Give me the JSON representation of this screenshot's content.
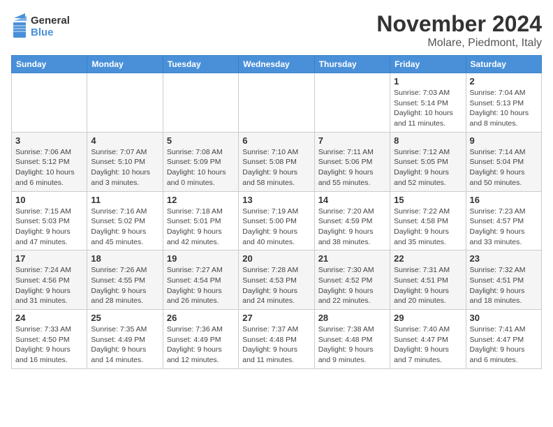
{
  "header": {
    "logo_general": "General",
    "logo_blue": "Blue",
    "month_title": "November 2024",
    "location": "Molare, Piedmont, Italy"
  },
  "days_of_week": [
    "Sunday",
    "Monday",
    "Tuesday",
    "Wednesday",
    "Thursday",
    "Friday",
    "Saturday"
  ],
  "weeks": [
    [
      {
        "day": "",
        "info": ""
      },
      {
        "day": "",
        "info": ""
      },
      {
        "day": "",
        "info": ""
      },
      {
        "day": "",
        "info": ""
      },
      {
        "day": "",
        "info": ""
      },
      {
        "day": "1",
        "info": "Sunrise: 7:03 AM\nSunset: 5:14 PM\nDaylight: 10 hours and 11 minutes."
      },
      {
        "day": "2",
        "info": "Sunrise: 7:04 AM\nSunset: 5:13 PM\nDaylight: 10 hours and 8 minutes."
      }
    ],
    [
      {
        "day": "3",
        "info": "Sunrise: 7:06 AM\nSunset: 5:12 PM\nDaylight: 10 hours and 6 minutes."
      },
      {
        "day": "4",
        "info": "Sunrise: 7:07 AM\nSunset: 5:10 PM\nDaylight: 10 hours and 3 minutes."
      },
      {
        "day": "5",
        "info": "Sunrise: 7:08 AM\nSunset: 5:09 PM\nDaylight: 10 hours and 0 minutes."
      },
      {
        "day": "6",
        "info": "Sunrise: 7:10 AM\nSunset: 5:08 PM\nDaylight: 9 hours and 58 minutes."
      },
      {
        "day": "7",
        "info": "Sunrise: 7:11 AM\nSunset: 5:06 PM\nDaylight: 9 hours and 55 minutes."
      },
      {
        "day": "8",
        "info": "Sunrise: 7:12 AM\nSunset: 5:05 PM\nDaylight: 9 hours and 52 minutes."
      },
      {
        "day": "9",
        "info": "Sunrise: 7:14 AM\nSunset: 5:04 PM\nDaylight: 9 hours and 50 minutes."
      }
    ],
    [
      {
        "day": "10",
        "info": "Sunrise: 7:15 AM\nSunset: 5:03 PM\nDaylight: 9 hours and 47 minutes."
      },
      {
        "day": "11",
        "info": "Sunrise: 7:16 AM\nSunset: 5:02 PM\nDaylight: 9 hours and 45 minutes."
      },
      {
        "day": "12",
        "info": "Sunrise: 7:18 AM\nSunset: 5:01 PM\nDaylight: 9 hours and 42 minutes."
      },
      {
        "day": "13",
        "info": "Sunrise: 7:19 AM\nSunset: 5:00 PM\nDaylight: 9 hours and 40 minutes."
      },
      {
        "day": "14",
        "info": "Sunrise: 7:20 AM\nSunset: 4:59 PM\nDaylight: 9 hours and 38 minutes."
      },
      {
        "day": "15",
        "info": "Sunrise: 7:22 AM\nSunset: 4:58 PM\nDaylight: 9 hours and 35 minutes."
      },
      {
        "day": "16",
        "info": "Sunrise: 7:23 AM\nSunset: 4:57 PM\nDaylight: 9 hours and 33 minutes."
      }
    ],
    [
      {
        "day": "17",
        "info": "Sunrise: 7:24 AM\nSunset: 4:56 PM\nDaylight: 9 hours and 31 minutes."
      },
      {
        "day": "18",
        "info": "Sunrise: 7:26 AM\nSunset: 4:55 PM\nDaylight: 9 hours and 28 minutes."
      },
      {
        "day": "19",
        "info": "Sunrise: 7:27 AM\nSunset: 4:54 PM\nDaylight: 9 hours and 26 minutes."
      },
      {
        "day": "20",
        "info": "Sunrise: 7:28 AM\nSunset: 4:53 PM\nDaylight: 9 hours and 24 minutes."
      },
      {
        "day": "21",
        "info": "Sunrise: 7:30 AM\nSunset: 4:52 PM\nDaylight: 9 hours and 22 minutes."
      },
      {
        "day": "22",
        "info": "Sunrise: 7:31 AM\nSunset: 4:51 PM\nDaylight: 9 hours and 20 minutes."
      },
      {
        "day": "23",
        "info": "Sunrise: 7:32 AM\nSunset: 4:51 PM\nDaylight: 9 hours and 18 minutes."
      }
    ],
    [
      {
        "day": "24",
        "info": "Sunrise: 7:33 AM\nSunset: 4:50 PM\nDaylight: 9 hours and 16 minutes."
      },
      {
        "day": "25",
        "info": "Sunrise: 7:35 AM\nSunset: 4:49 PM\nDaylight: 9 hours and 14 minutes."
      },
      {
        "day": "26",
        "info": "Sunrise: 7:36 AM\nSunset: 4:49 PM\nDaylight: 9 hours and 12 minutes."
      },
      {
        "day": "27",
        "info": "Sunrise: 7:37 AM\nSunset: 4:48 PM\nDaylight: 9 hours and 11 minutes."
      },
      {
        "day": "28",
        "info": "Sunrise: 7:38 AM\nSunset: 4:48 PM\nDaylight: 9 hours and 9 minutes."
      },
      {
        "day": "29",
        "info": "Sunrise: 7:40 AM\nSunset: 4:47 PM\nDaylight: 9 hours and 7 minutes."
      },
      {
        "day": "30",
        "info": "Sunrise: 7:41 AM\nSunset: 4:47 PM\nDaylight: 9 hours and 6 minutes."
      }
    ]
  ]
}
